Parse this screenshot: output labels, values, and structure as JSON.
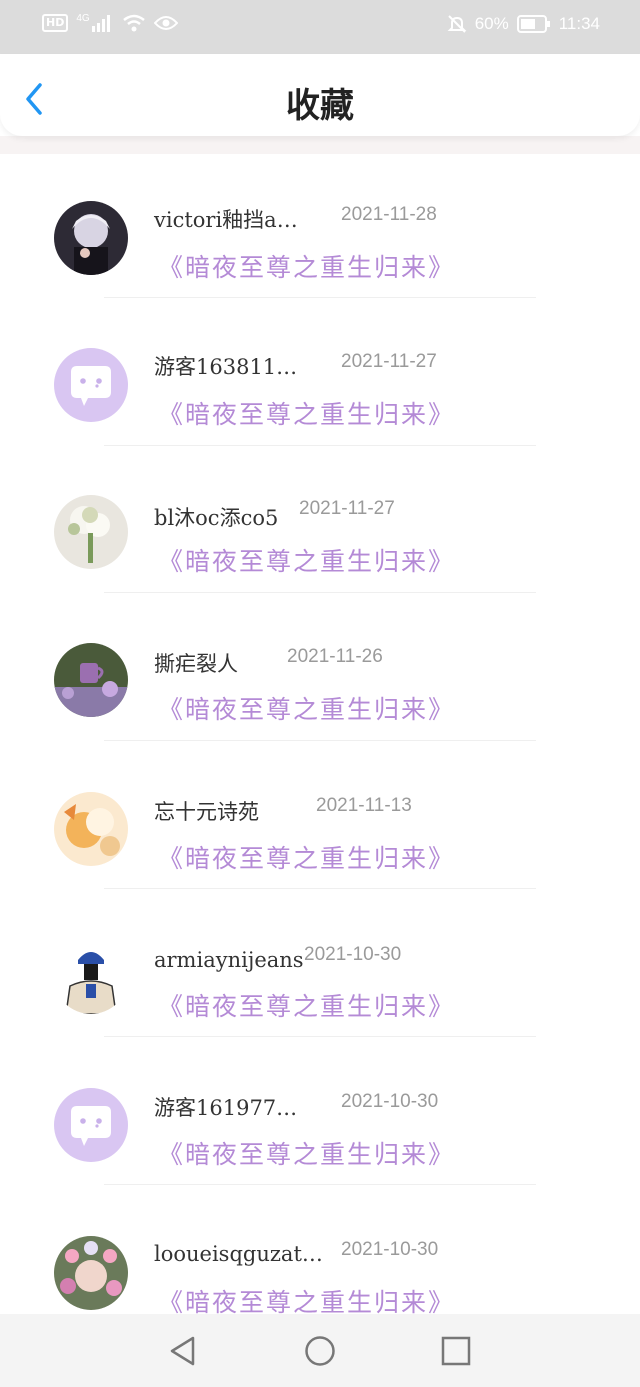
{
  "status_bar": {
    "hd": "HD",
    "network": "4G",
    "battery": "60%",
    "time": "11:34"
  },
  "header": {
    "title": "收藏"
  },
  "items": [
    {
      "name": "victori釉挡a…",
      "date": "2021-11-28",
      "book": "《暗夜至尊之重生归来》",
      "avatar": "anime-boy-avatar"
    },
    {
      "name": "游客163811…",
      "date": "2021-11-27",
      "book": "《暗夜至尊之重生归来》",
      "avatar": "default-chat-avatar"
    },
    {
      "name": "bl沐oc添co5",
      "date": "2021-11-27",
      "book": "《暗夜至尊之重生归来》",
      "avatar": "flower-bouquet-avatar"
    },
    {
      "name": "撕疟裂人",
      "date": "2021-11-26",
      "book": "《暗夜至尊之重生归来》",
      "avatar": "purple-cup-avatar"
    },
    {
      "name": "忘十元诗苑",
      "date": "2021-11-13",
      "book": "《暗夜至尊之重生归来》",
      "avatar": "anime-fox-avatar"
    },
    {
      "name": "armiaynijeans",
      "date": "2021-10-30",
      "book": "《暗夜至尊之重生归来》",
      "avatar": "cartoon-person-avatar"
    },
    {
      "name": "游客161977…",
      "date": "2021-10-30",
      "book": "《暗夜至尊之重生归来》",
      "avatar": "default-chat-avatar"
    },
    {
      "name": "looueisqguzat…",
      "date": "2021-10-30",
      "book": "《暗夜至尊之重生归来》",
      "avatar": "flower-girl-avatar"
    }
  ],
  "colors": {
    "accent": "#2196f3",
    "book_title": "#b48ad6",
    "default_avatar_bg": "#d9c6f2"
  },
  "nav": {
    "back": "triangle-back-icon",
    "home": "circle-home-icon",
    "recents": "square-recents-icon"
  }
}
